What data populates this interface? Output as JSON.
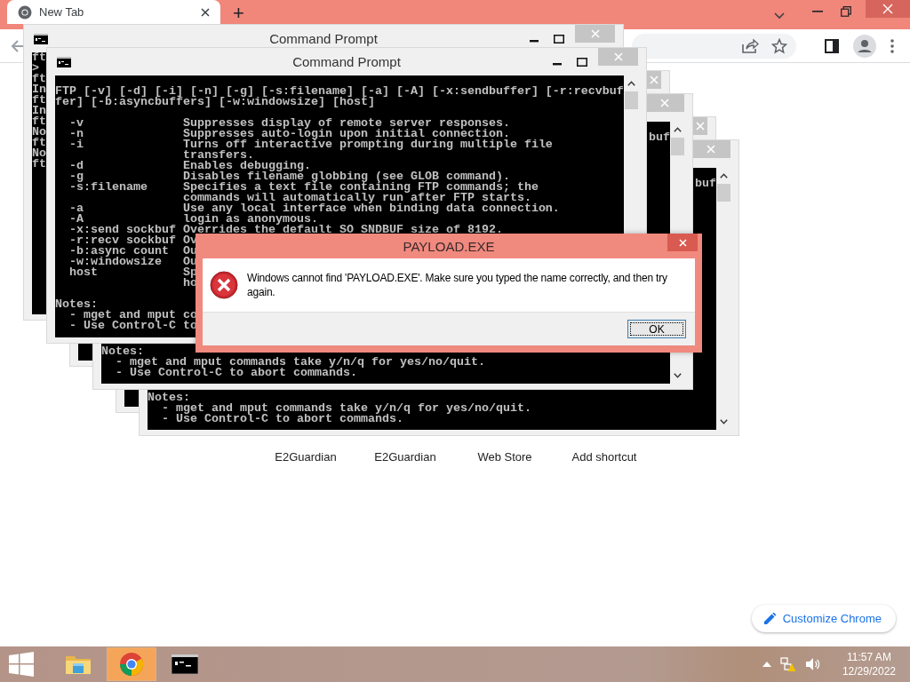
{
  "browser": {
    "tab": {
      "title": "New Tab",
      "selected": true
    },
    "new_tab_button": "+",
    "shortcuts": [
      "E2Guardian",
      "E2Guardian",
      "Web Store",
      "Add shortcut"
    ],
    "customize_button": "Customize Chrome"
  },
  "console_windows": [
    {
      "kind": "console",
      "title": "Command Prompt",
      "blocks": [
        [
          "ft",
          ">",
          "ft",
          "In",
          "ft",
          "In",
          "ft",
          "No",
          "ft",
          "No",
          "ft"
        ]
      ]
    },
    {
      "kind": "console",
      "title": "Command Prompt",
      "blocks": [
        [
          "FTP [-v] [-d] [-i] [-n] [-g] [-s:filename] [-a] [-A] [-x:sendbuffer] [-r:recvbuf",
          "fer] [-b:asyncbuffers] [-w:windowsize] [host]"
        ],
        [
          "  -v              Suppresses display of remote server responses.",
          "  -n              Suppresses auto-login upon initial connection.",
          "  -i              Turns off interactive prompting during multiple file",
          "                  transfers.",
          "  -d              Enables debugging.",
          "  -g              Disables filename globbing (see GLOB command).",
          "  -s:filename     Specifies a text file containing FTP commands; the",
          "                  commands will automatically run after FTP starts.",
          "  -a              Use any local interface when binding data connection.",
          "  -A              login as anonymous.",
          "  -x:send sockbuf Overrides the default SO SNDBUF size of 8192.",
          "  -r:recv sockbuf Ov",
          "  -b:async count  Ou",
          "  -w:windowsize   Ou",
          "  host            Sp",
          "                  ho"
        ],
        [
          "Notes:",
          "  - mget and mput co",
          "  - Use Control-C to"
        ]
      ]
    },
    {
      "kind": "console"
    },
    {
      "kind": "console",
      "line_1_end": "buf",
      "bottom_lines": [
        "Notes:",
        "  - mget and mput commands take y/n/q for yes/no/quit.",
        "  - Use Control-C to abort commands."
      ]
    },
    {
      "kind": "console"
    },
    {
      "kind": "console",
      "line_1_end": "buf",
      "bottom_lines": [
        "Notes:",
        "  - mget and mput commands take y/n/q for yes/no/quit.",
        "  - Use Control-C to abort commands."
      ]
    }
  ],
  "dialog": {
    "title": "PAYLOAD.EXE",
    "message": "Windows cannot find 'PAYLOAD.EXE'. Make sure you typed the name correctly, and then try again.",
    "buttons": [
      "OK"
    ]
  },
  "taskbar": {
    "apps": [
      {
        "kind": "explorer",
        "selected": false
      },
      {
        "kind": "chrome",
        "selected": true
      },
      {
        "kind": "console",
        "selected": false
      }
    ],
    "clock": {
      "time": "11:57 AM",
      "date": "12/29/2022"
    }
  }
}
